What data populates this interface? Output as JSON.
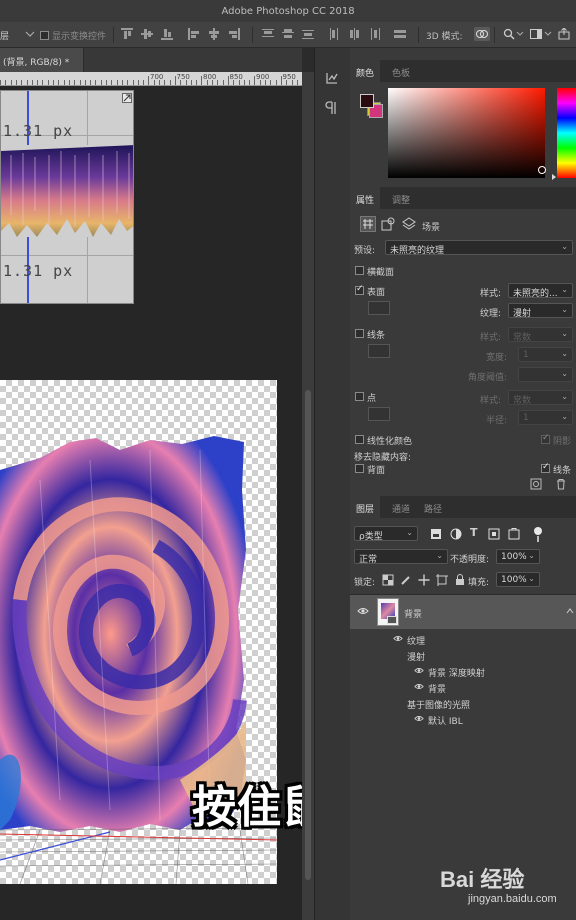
{
  "app": {
    "title": "Adobe Photoshop CC 2018"
  },
  "options_bar": {
    "layer_dropdown": "层",
    "show_transform": "显示变换控件",
    "mode_3d": "3D 模式:"
  },
  "document": {
    "tab_label": "(背景, RGB/8) *",
    "ruler_labels": [
      "700",
      "750",
      "800",
      "850",
      "900",
      "950",
      "1000",
      "1050",
      "1100",
      "1150",
      "1200"
    ],
    "preview_measure_top": "1.31 px",
    "preview_measure_bottom": "1.31 px",
    "caption": "按住鼠标"
  },
  "color_panel": {
    "tabs": [
      "颜色",
      "色板"
    ],
    "foreground": "#2a0c10",
    "background": "#d1357c"
  },
  "properties_panel": {
    "tabs": [
      "属性",
      "调整"
    ],
    "mode_label": "场景",
    "preset_label": "预设:",
    "preset_value": "未照亮的纹理",
    "cross_section": "横截面",
    "surface": {
      "label": "表面",
      "checked": true,
      "style_label": "样式:",
      "style_value": "未照亮的...",
      "texture_label": "纹理:",
      "texture_value": "漫射"
    },
    "lines": {
      "label": "线条",
      "checked": false,
      "style_label": "样式:",
      "style_value": "常数",
      "width_label": "宽度:",
      "width_value": "1",
      "angle_label": "角度阈值:"
    },
    "points": {
      "label": "点",
      "checked": false,
      "style_label": "样式:",
      "style_value": "常数",
      "radius_label": "半径:",
      "radius_value": "1"
    },
    "linearize_colors": "线性化颜色",
    "shadow": "阴影",
    "remove_hidden": "移去隐藏内容:",
    "back_face": "背面",
    "lines_right": "线条"
  },
  "layers_panel": {
    "tabs": [
      "图层",
      "通道",
      "路径"
    ],
    "kind_filter": "ρ类型",
    "blend_mode": "正常",
    "opacity_label": "不透明度:",
    "opacity_value": "100%",
    "lock_label": "锁定:",
    "fill_label": "填充:",
    "fill_value": "100%",
    "layers": [
      {
        "name": "背景",
        "indent": 0
      },
      {
        "name": "纹理",
        "indent": 1
      },
      {
        "name": "漫射",
        "indent": 2
      },
      {
        "name": "背景 深度映射",
        "indent": 3
      },
      {
        "name": "背景",
        "indent": 3
      },
      {
        "name": "基于图像的光照",
        "indent": 2
      },
      {
        "name": "默认 IBL",
        "indent": 3
      }
    ]
  },
  "watermark": {
    "logo": "Bai 经验",
    "url": "jingyan.baidu.com"
  },
  "icons": [
    "chain-icon",
    "layers-3d-icon",
    "search-icon",
    "workspace-icon",
    "collapse-icon",
    "eye-icon",
    "lock-icon",
    "trash-icon"
  ]
}
